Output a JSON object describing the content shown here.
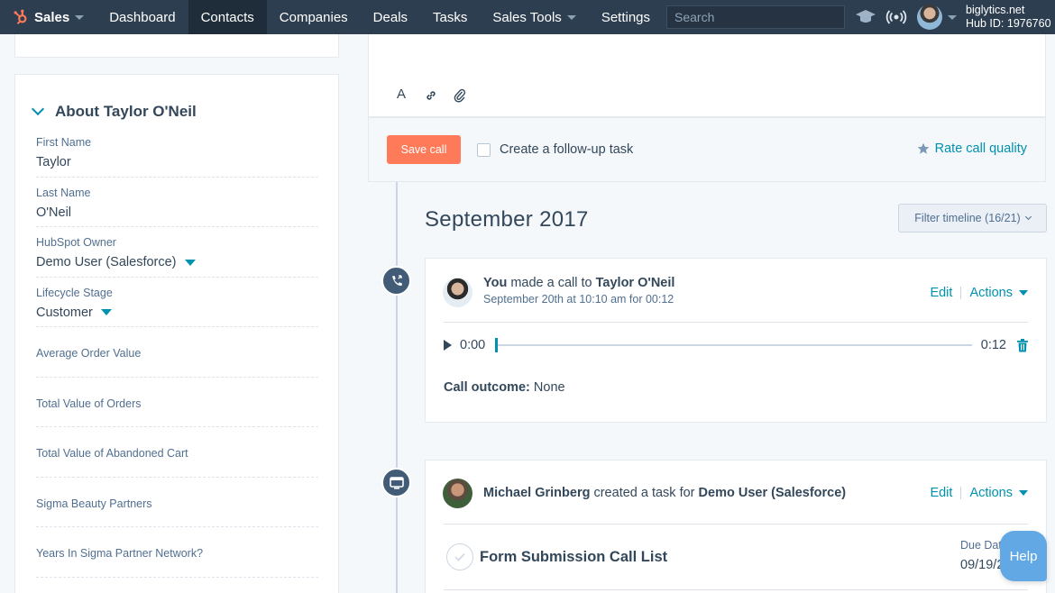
{
  "nav": {
    "brand": "Sales",
    "items": [
      "Dashboard",
      "Contacts",
      "Companies",
      "Deals",
      "Tasks",
      "Sales Tools",
      "Settings"
    ],
    "active": "Contacts",
    "search_placeholder": "Search",
    "account_domain": "biglytics.net",
    "hub_id": "Hub ID: 1976760"
  },
  "about": {
    "title": "About Taylor O'Neil",
    "properties": [
      {
        "label": "First Name",
        "value": "Taylor"
      },
      {
        "label": "Last Name",
        "value": "O'Neil"
      },
      {
        "label": "HubSpot Owner",
        "value": "Demo User (Salesforce)"
      },
      {
        "label": "Lifecycle Stage",
        "value": "Customer"
      },
      {
        "label": "Average Order Value",
        "value": ""
      },
      {
        "label": "Total Value of Orders",
        "value": ""
      },
      {
        "label": "Total Value of Abandoned Cart",
        "value": ""
      },
      {
        "label": "Sigma Beauty Partners",
        "value": ""
      },
      {
        "label": "Years In Sigma Partner Network?",
        "value": ""
      }
    ]
  },
  "composer": {
    "save_label": "Save call",
    "followup_label": "Create a follow-up task",
    "rate_label": "Rate call quality"
  },
  "timeline": {
    "month": "September 2017",
    "filter_label": "Filter timeline (16/21)",
    "call": {
      "actor": "You",
      "verb": " made a call to ",
      "target": "Taylor O'Neil",
      "meta": "September 20th at 10:10 am for 00:12",
      "time_start": "0:00",
      "time_end": "0:12",
      "outcome_label": "Call outcome:",
      "outcome_value": " None"
    },
    "task": {
      "actor": "Michael Grinberg",
      "verb": " created a task for ",
      "target": "Demo User (Salesforce)",
      "title": "Form Submission Call List",
      "due_label": "Due Dat",
      "due_value": "09/19/2"
    },
    "edit_label": "Edit",
    "actions_label": "Actions"
  },
  "help_label": "Help"
}
